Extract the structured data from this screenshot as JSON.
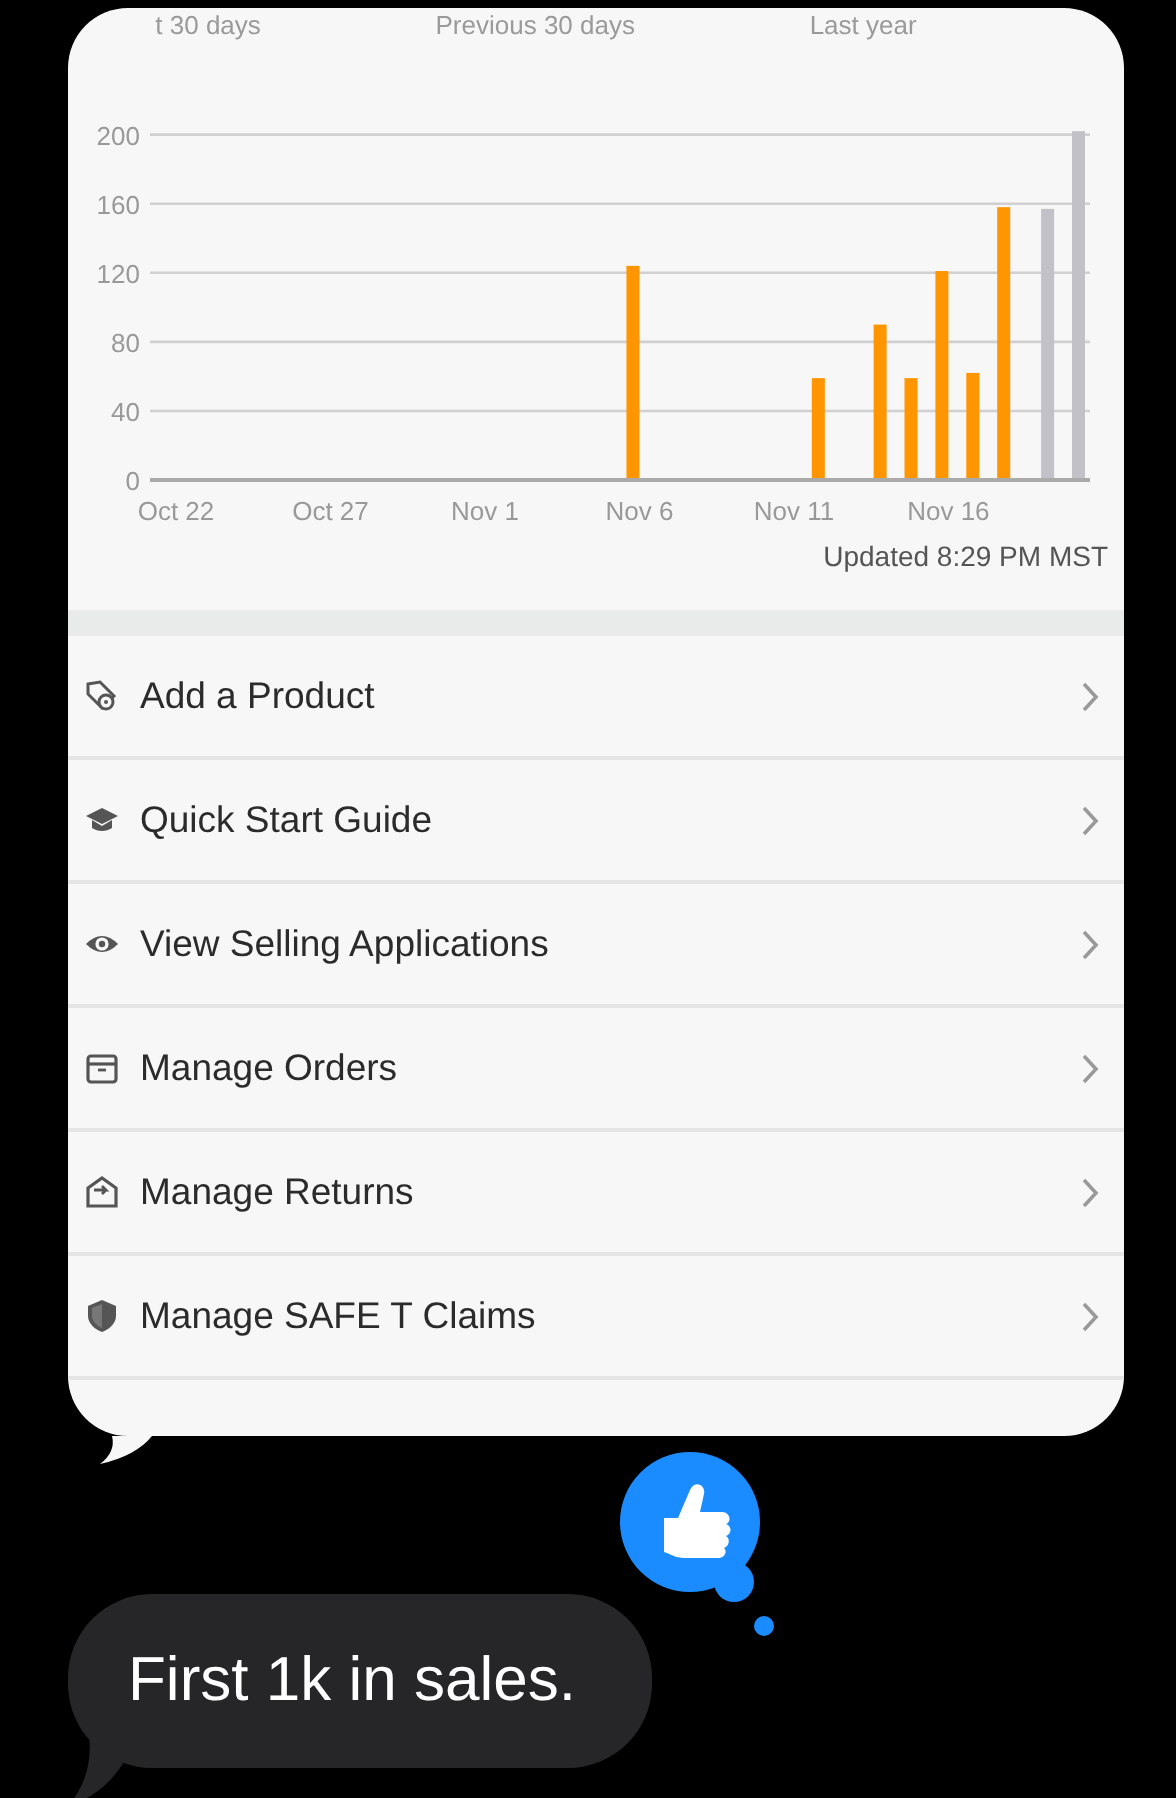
{
  "legend": [
    "t 30 days",
    "Previous 30 days",
    "Last year"
  ],
  "chart_data": {
    "type": "bar",
    "grid": true,
    "categories": [
      "Oct 22",
      null,
      null,
      null,
      null,
      "Oct 27",
      null,
      null,
      null,
      null,
      "Nov 1",
      null,
      null,
      null,
      null,
      "Nov 6",
      null,
      null,
      null,
      null,
      "Nov 11",
      null,
      null,
      null,
      null,
      "Nov 16",
      null,
      null,
      null,
      null
    ],
    "yticks": [
      0,
      40,
      80,
      120,
      160,
      200
    ],
    "ylim": [
      0,
      205
    ],
    "series": [
      {
        "color": "#ff9500",
        "values": [
          0,
          0,
          0,
          0,
          0,
          0,
          0,
          0,
          0,
          0,
          0,
          0,
          0,
          0,
          0,
          124,
          0,
          0,
          0,
          0,
          0,
          59,
          0,
          90,
          59,
          121,
          62,
          158,
          null,
          null
        ]
      },
      {
        "color": "#c2c1c7",
        "values": [
          null,
          null,
          null,
          null,
          null,
          null,
          null,
          null,
          null,
          null,
          null,
          null,
          null,
          null,
          null,
          null,
          null,
          null,
          null,
          null,
          null,
          null,
          null,
          null,
          null,
          null,
          null,
          null,
          157,
          202
        ]
      }
    ]
  },
  "updated": "Updated 8:29 PM MST",
  "menu": [
    {
      "kind": "tag",
      "label": "Add a Product"
    },
    {
      "kind": "cap",
      "label": "Quick Start Guide"
    },
    {
      "kind": "eye",
      "label": "View Selling Applications"
    },
    {
      "kind": "box",
      "label": "Manage Orders"
    },
    {
      "kind": "return",
      "label": "Manage Returns"
    },
    {
      "kind": "shield",
      "label": "Manage SAFE T Claims"
    }
  ],
  "message": "First 1k in sales."
}
